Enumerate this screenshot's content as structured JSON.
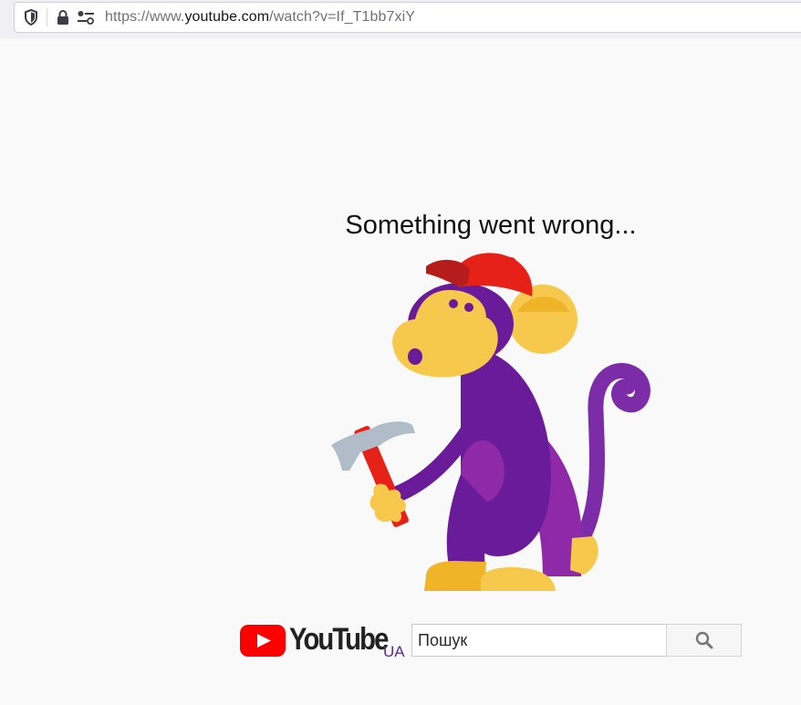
{
  "browser": {
    "url_prefix": "https://www.",
    "url_host": "youtube.com",
    "url_rest": "/watch?v=If_T1bb7xiY",
    "icons": [
      "shield-icon",
      "lock-icon",
      "permissions-icon"
    ]
  },
  "error": {
    "title": "Something went wrong...",
    "illustration": "monkey-with-hammer"
  },
  "footer": {
    "logo_text": "YouTube",
    "country_code": "UA",
    "search_placeholder": "Пошук",
    "search_icon": "search-icon"
  },
  "colors": {
    "youtube_red": "#ff0000",
    "monkey_purple": "#6a1b9a",
    "monkey_yellow": "#f6c94c",
    "cap_red": "#e62117"
  }
}
